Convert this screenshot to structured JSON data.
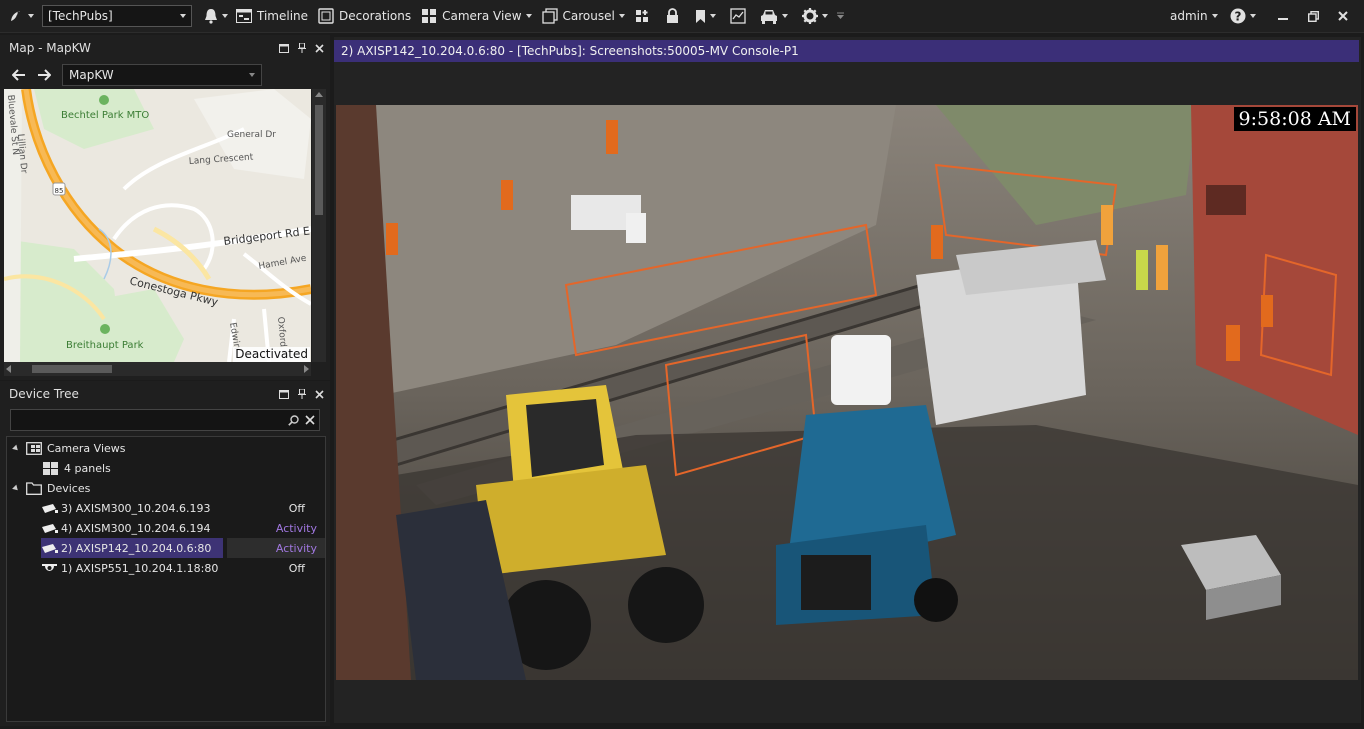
{
  "toolbar": {
    "site_select": "[TechPubs]",
    "timeline": "Timeline",
    "decorations": "Decorations",
    "camera_view": "Camera View",
    "carousel": "Carousel",
    "user": "admin"
  },
  "map_panel": {
    "title": "Map - MapKW",
    "map_select": "MapKW",
    "status": "Deactivated",
    "labels": {
      "bechtel": "Bechtel Park MTO",
      "general": "General Dr",
      "lang": "Lang Crescent",
      "bridgeport": "Bridgeport Rd E",
      "hamel": "Hamel Ave",
      "conestoga": "Conestoga Pkwy",
      "breithaupt": "Breithaupt Park",
      "edwin": "Edwin",
      "oxford": "Oxford",
      "bluevale": "Bluevale St N",
      "lillian": "Lillian Dr",
      "hwy": "85"
    }
  },
  "device_tree": {
    "title": "Device Tree",
    "search_placeholder": "",
    "camera_views_label": "Camera Views",
    "four_panels_label": "4 panels",
    "devices_label": "Devices",
    "devices": [
      {
        "name": "3) AXISM300_10.204.6.193",
        "status": "Off"
      },
      {
        "name": "4) AXISM300_10.204.6.194",
        "status": "Activity"
      },
      {
        "name": "2) AXISP142_10.204.0.6:80",
        "status": "Activity"
      },
      {
        "name": "1) AXISP551_10.204.1.18:80",
        "status": "Off"
      }
    ]
  },
  "video_tile": {
    "title": "2) AXISP142_10.204.0.6:80 - [TechPubs]: Screenshots:50005-MV Console-P1",
    "timestamp": "9:58:08 AM"
  },
  "colors": {
    "accent": "#3b2f78",
    "activity": "#a178e0",
    "selected_row": "#3d3375"
  },
  "icons": [
    "app-logo-icon",
    "bell-icon",
    "timeline-icon",
    "decorations-icon",
    "camera-view-icon",
    "carousel-icon",
    "layout-icon",
    "lock-icon",
    "bookmark-icon",
    "report-icon",
    "vehicle-icon",
    "gear-icon",
    "help-icon",
    "minimize-icon",
    "restore-icon",
    "close-icon",
    "back-arrow-icon",
    "forward-arrow-icon",
    "search-icon",
    "folder-icon",
    "camera-icon"
  ]
}
